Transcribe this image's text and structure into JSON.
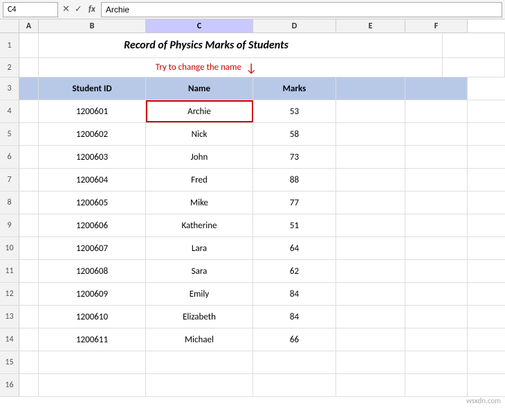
{
  "formulaBar": {
    "cellRef": "C4",
    "cancelIcon": "✕",
    "confirmIcon": "✓",
    "funcIcon": "fx",
    "value": "Archie"
  },
  "title": "Record of Physics Marks of Students",
  "annotation": "Try to change the name",
  "columns": {
    "A": {
      "label": "A"
    },
    "B": {
      "label": "B"
    },
    "C": {
      "label": "C",
      "active": true
    },
    "D": {
      "label": "D"
    },
    "E": {
      "label": "E"
    },
    "F": {
      "label": "F"
    }
  },
  "tableHeaders": {
    "studentId": "Student ID",
    "name": "Name",
    "marks": "Marks"
  },
  "rows": [
    {
      "rowNum": "1",
      "type": "title"
    },
    {
      "rowNum": "2",
      "type": "annotation"
    },
    {
      "rowNum": "3",
      "type": "header"
    },
    {
      "rowNum": "4",
      "studentId": "1200601",
      "name": "Archie",
      "marks": "53",
      "active": true
    },
    {
      "rowNum": "5",
      "studentId": "1200602",
      "name": "Nick",
      "marks": "58"
    },
    {
      "rowNum": "6",
      "studentId": "1200603",
      "name": "John",
      "marks": "73"
    },
    {
      "rowNum": "7",
      "studentId": "1200604",
      "name": "Fred",
      "marks": "88"
    },
    {
      "rowNum": "8",
      "studentId": "1200605",
      "name": "Mike",
      "marks": "77"
    },
    {
      "rowNum": "9",
      "studentId": "1200606",
      "name": "Katherine",
      "marks": "51"
    },
    {
      "rowNum": "10",
      "studentId": "1200607",
      "name": "Lara",
      "marks": "64"
    },
    {
      "rowNum": "11",
      "studentId": "1200608",
      "name": "Sara",
      "marks": "62"
    },
    {
      "rowNum": "12",
      "studentId": "1200609",
      "name": "Emily",
      "marks": "84"
    },
    {
      "rowNum": "13",
      "studentId": "1200610",
      "name": "Elizabeth",
      "marks": "84"
    },
    {
      "rowNum": "14",
      "studentId": "1200611",
      "name": "Michael",
      "marks": "66"
    },
    {
      "rowNum": "15",
      "type": "empty"
    },
    {
      "rowNum": "16",
      "type": "empty"
    }
  ],
  "watermark": "wsxdn.com"
}
